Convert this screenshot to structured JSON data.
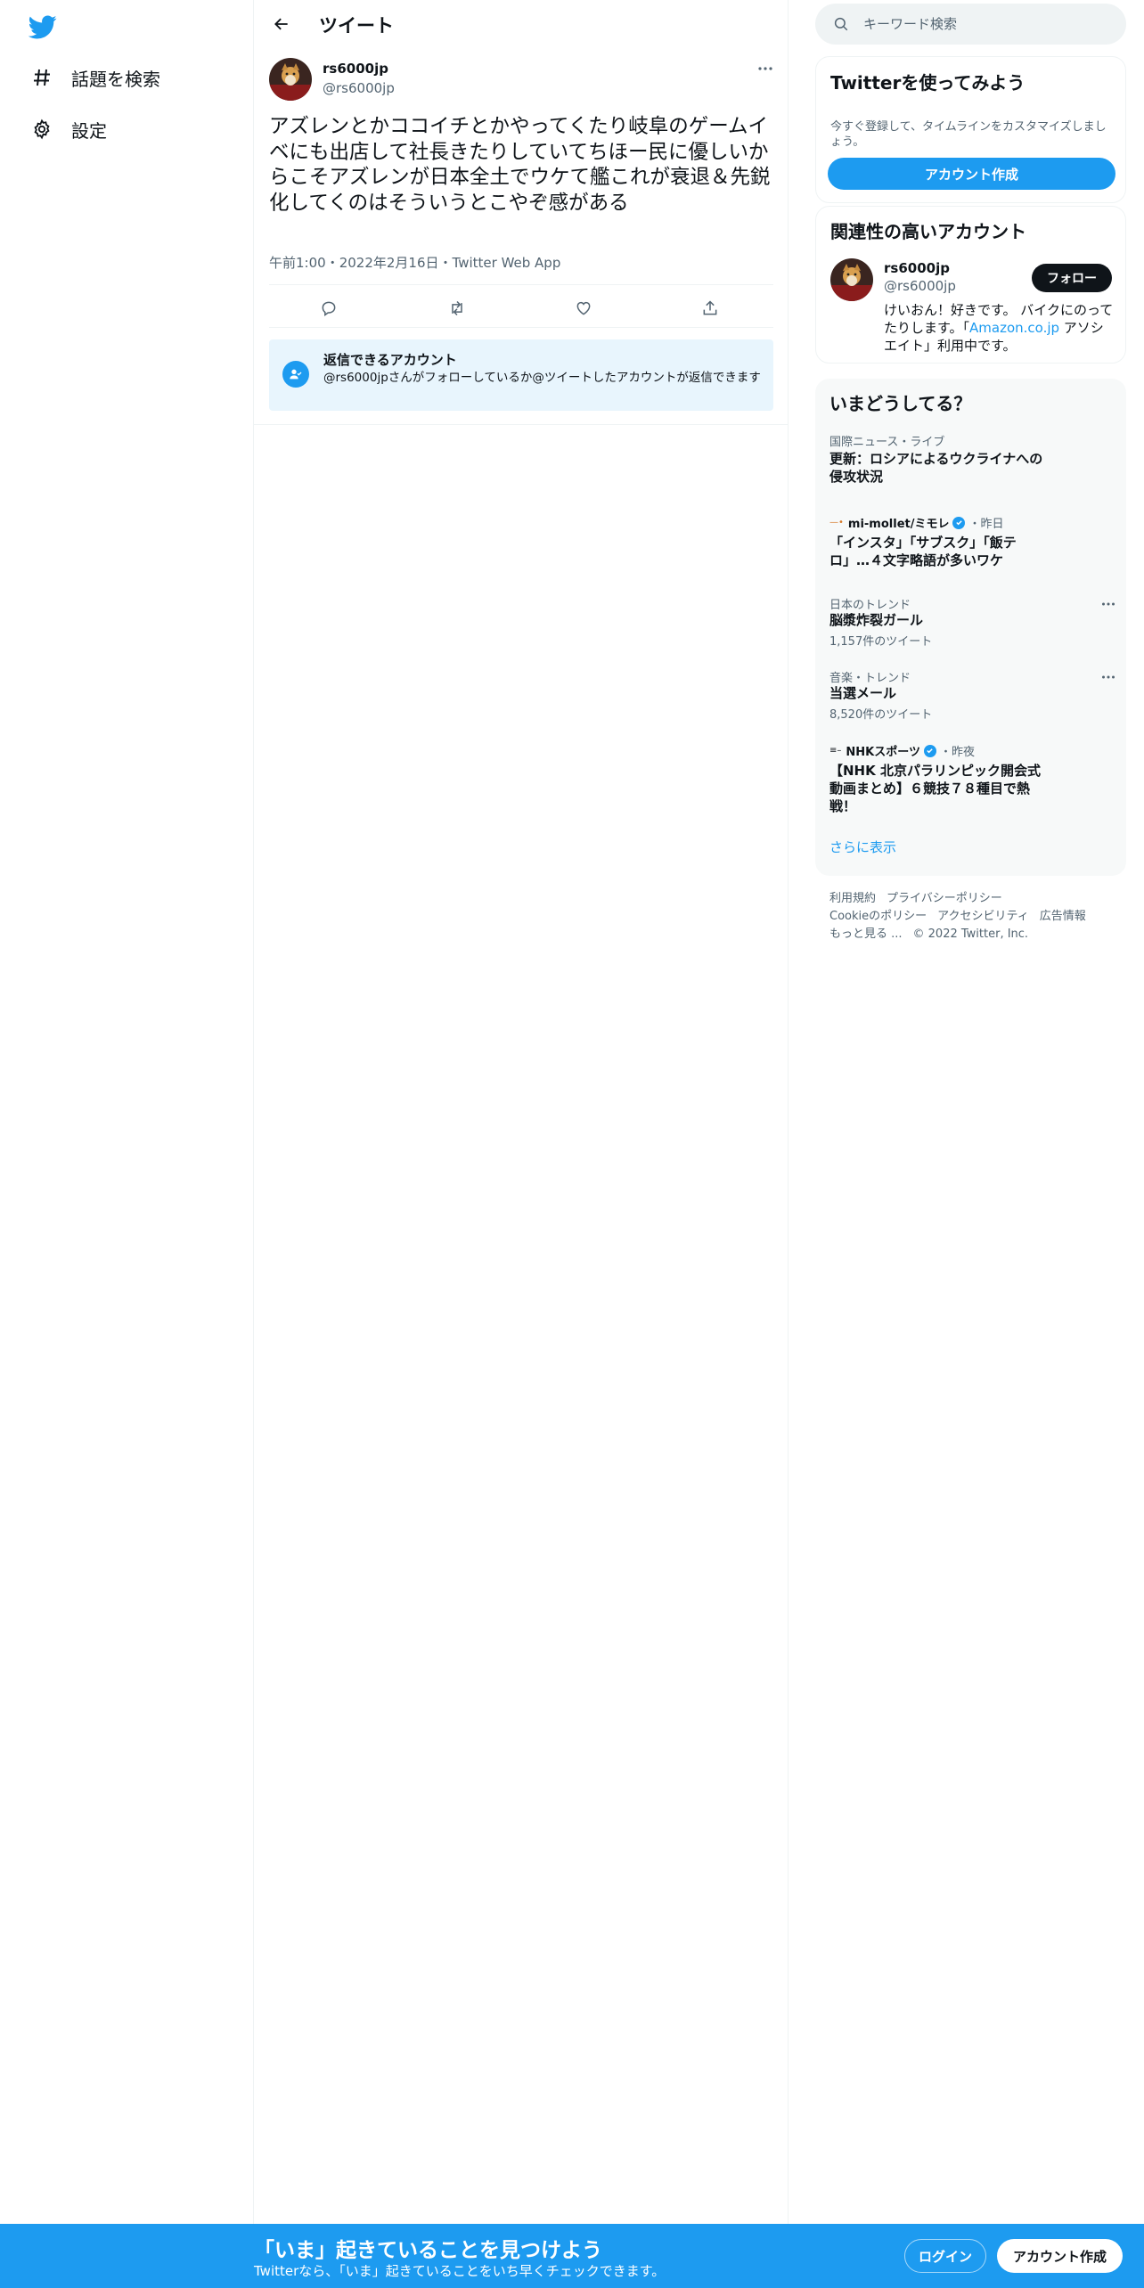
{
  "nav": {
    "explore_label": "話題を検索",
    "settings_label": "設定"
  },
  "header": {
    "title": "ツイート"
  },
  "tweet": {
    "name": "rs6000jp",
    "handle": "@rs6000jp",
    "text": "アズレンとかココイチとかやってくたり岐阜のゲームイベにも出店して社長きたりしていてちほー民に優しいからこそアズレンが日本全土でウケて艦これが衰退＆先鋭化してくのはそういうとこやぞ感がある",
    "time": "午前1:00",
    "date": "2022年2月16日",
    "source": "Twitter Web App",
    "separator": "・"
  },
  "reply_restriction": {
    "title": "返信できるアカウント",
    "body": "@rs6000jpさんがフォローしているか@ツイートしたアカウントが返信できます"
  },
  "search": {
    "placeholder": "キーワード検索"
  },
  "signup_panel": {
    "title": "Twitterを使ってみよう",
    "subtitle": "今すぐ登録して、タイムラインをカスタマイズしましょう。",
    "button_label": "アカウント作成"
  },
  "related": {
    "title": "関連性の高いアカウント",
    "name": "rs6000jp",
    "handle": "@rs6000jp",
    "follow_label": "フォロー",
    "bio_prefix": "けいおん！好きです。 バイクにのってたりします。「",
    "bio_link": "Amazon.co.jp",
    "bio_suffix": " アソシエイト」利用中です。"
  },
  "trends": {
    "title": "いまどうしてる？",
    "items": [
      {
        "context": "国際ニュース・ライブ",
        "title": "更新：ロシアによるウクライナへの侵攻状況",
        "count": ""
      },
      {
        "source": "mi-mollet/ミモレ",
        "when": "・昨日",
        "title": "「インスタ」「サブスク」「飯テロ」…４文字略語が多いワケ",
        "count": ""
      },
      {
        "context": "日本のトレンド",
        "title": "脳漿炸裂ガール",
        "count": "1,157件のツイート"
      },
      {
        "context": "音楽・トレンド",
        "title": "当選メール",
        "count": "8,520件のツイート"
      },
      {
        "source": "NHKスポーツ",
        "when": "・昨夜",
        "title": "【NHK 北京パラリンピック開会式動画まとめ】６競技７８種目で熱戦！",
        "count": ""
      }
    ],
    "show_more": "さらに表示"
  },
  "footer": {
    "terms": "利用規約",
    "privacy": "プライバシーポリシー",
    "cookie": "Cookieのポリシー",
    "accessibility": "アクセシビリティ",
    "ads": "広告情報",
    "more": "もっと見る ...",
    "copyright": "© 2022 Twitter, Inc."
  },
  "bottom_bar": {
    "title": "「いま」起きていることを見つけよう",
    "subtitle": "Twitterなら、「いま」起きていることをいち早くチェックできます。",
    "login_label": "ログイン",
    "signup_label": "アカウント作成"
  },
  "colors": {
    "brand": "#1d9bf0",
    "text": "#0f1419",
    "muted": "#536471",
    "reply_bg": "#e8f5fd"
  }
}
